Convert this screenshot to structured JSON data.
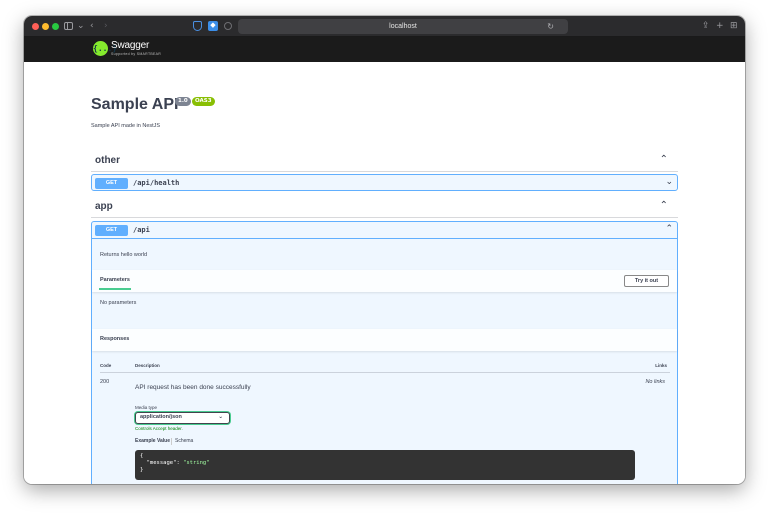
{
  "browser": {
    "url": "localhost",
    "icons": [
      "sidebar-icon",
      "chevron-down-icon",
      "back-arrow-icon",
      "forward-arrow-icon",
      "reload-icon",
      "share-icon",
      "new-tab-icon",
      "tab-overview-icon"
    ]
  },
  "topbar": {
    "logo_text": "Swagger",
    "logo_sub": "Supported by SMARTBEAR",
    "logo_glyph": "{...}"
  },
  "info": {
    "title": "Sample API",
    "version": "1.0",
    "oas": "OAS3",
    "description": "Sample API made in NestJS"
  },
  "tags": [
    {
      "name": "other",
      "operations": [
        {
          "method": "GET",
          "path": "/api/health"
        }
      ]
    },
    {
      "name": "app",
      "operations": [
        {
          "method": "GET",
          "path": "/api",
          "description": "Returns hello world",
          "parameters_tab": "Parameters",
          "try_button": "Try it out",
          "no_params": "No parameters",
          "responses_title": "Responses",
          "columns": {
            "code": "Code",
            "description": "Description",
            "links": "Links"
          },
          "response": {
            "code": "200",
            "description": "API request has been done successfully",
            "links": "No links",
            "media_type_label": "Media type",
            "media_type": "application/json",
            "controls_accept": "Controls Accept header.",
            "example_value_tab": "Example Value",
            "schema_tab": "Schema",
            "example": {
              "open": "{",
              "key": "\"message\"",
              "colon": ": ",
              "value": "\"string\"",
              "close": "}"
            }
          }
        }
      ]
    }
  ],
  "colors": {
    "get": "#61affe",
    "oas": "#89bf04",
    "version": "#7d8492",
    "topbar": "#1b1b1b",
    "logo": "#85ea2d"
  }
}
